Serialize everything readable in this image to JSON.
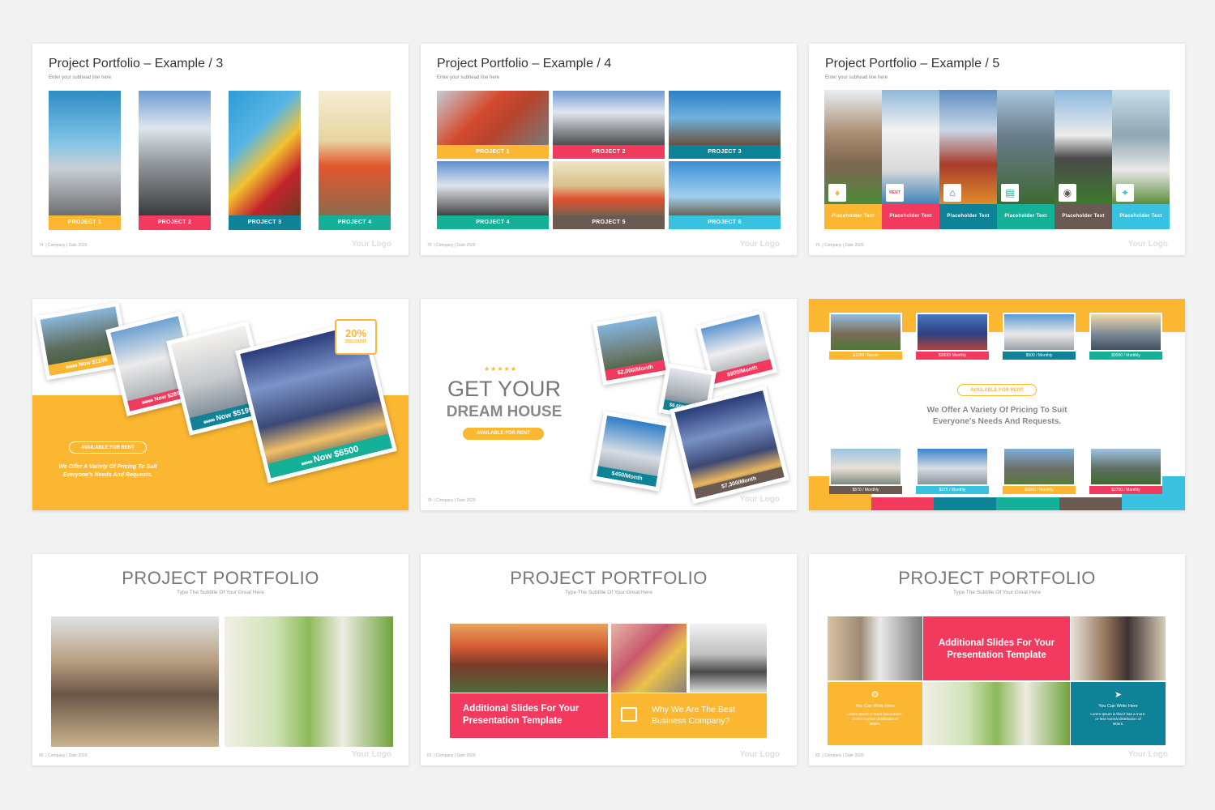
{
  "slides": {
    "s74": {
      "title": "Project Portfolio – Example / 3",
      "subhead": "Enter your subhead line here",
      "page": "74",
      "footer": "| Company | Date 2020",
      "logo": "Your Logo",
      "projects": [
        "PROJECT 1",
        "PROJECT 2",
        "PROJECT 3",
        "PROJECT 4"
      ]
    },
    "s75": {
      "title": "Project Portfolio – Example / 4",
      "subhead": "Enter your subhead line here",
      "page": "75",
      "footer": "| Company | Date 2020",
      "logo": "Your Logo",
      "projects": [
        "PROJECT 1",
        "PROJECT 2",
        "PROJECT 3",
        "PROJECT 4",
        "PROJECT 5",
        "PROJECT 6"
      ]
    },
    "s76": {
      "title": "Project Portfolio – Example / 5",
      "subhead": "Enter your subhead line here",
      "page": "76",
      "footer": "| Company | Date 2020",
      "logo": "Your Logo",
      "placeholders": [
        "Placeholder Text",
        "Placeholder Text",
        "Placeholder Text",
        "Placeholder Text",
        "Placeholder Text",
        "Placeholder Text"
      ],
      "icons": [
        "tag-icon",
        "rent-sign-icon",
        "house-location-icon",
        "document-icon",
        "map-pin-icon",
        "handshake-icon"
      ],
      "rent": "RENT"
    },
    "s77": {
      "discount": "20%",
      "discount_label": "DISCOUNT",
      "pill": "AVAILABLE FOR RENT",
      "desc1": "We Offer A Variety Of Pricing To Suit",
      "desc2": "Everyone's Needs And Requests.",
      "cards": [
        {
          "old": "$1999",
          "now": "Now $1199"
        },
        {
          "old": "$3999",
          "now": "Now $2899"
        },
        {
          "old": "$6999",
          "now": "Now $5199"
        },
        {
          "old": "$9000",
          "now": "Now $6500"
        }
      ]
    },
    "s78": {
      "stars": "★★★★★",
      "line1": "GET YOUR",
      "line2": "DREAM HOUSE",
      "pill": "AVAILABLE FOR RENT",
      "page": "78",
      "footer": "| Company | Date 2020",
      "logo": "Your Logo",
      "prices": [
        "$2,000/Month",
        "$900/Month",
        "$6,600/Month",
        "$450/Month",
        "$7,300/Month"
      ]
    },
    "s79": {
      "pill": "AVAILABLE FOR RENT",
      "desc1": "We Offer A Variety Of Pricing To Suit",
      "desc2": "Everyone's Needs And Requests.",
      "top": [
        "$1199 / Month",
        "$3000/ Monthly",
        "$500 / Monthly",
        "$9000 / Monthly"
      ],
      "bottom": [
        "$570 / Monthly",
        "$375 / Monthly",
        "$9000 / Monthly",
        "$2750 / Monthly"
      ]
    },
    "s80": {
      "title": "PROJECT PORTFOLIO",
      "subtitle": "Type The Subtitle Of Your Great Here",
      "page": "80",
      "footer": "| Company | Date 2020",
      "logo": "Your Logo"
    },
    "s81": {
      "title": "PROJECT PORTFOLIO",
      "subtitle": "Type The Subtitle Of Your Great Here",
      "page": "81",
      "footer": "| Company | Date 2020",
      "logo": "Your Logo",
      "box1": "Additional Slides For Your Presentation Template",
      "box2": "Why We Are The Best Business Company?"
    },
    "s82": {
      "title": "PROJECT PORTFOLIO",
      "subtitle": "Type The Subtitle Of Your Great Here",
      "page": "82",
      "footer": "| Company | Date 2020",
      "logo": "Your Logo",
      "box1": "Additional Slides For Your Presentation Template",
      "card1_title": "You Can Write Here",
      "card1_body": "Lorem Ipsum is that it has a more-or-less normal distribution of letters.",
      "card2_title": "You Can Write Here",
      "card2_body": "Lorem Ipsum is that it has a more-or-less normal distribution of letters."
    }
  },
  "colors": {
    "yellow": "#fbb731",
    "pink": "#f23a5f",
    "teal": "#0e8296",
    "green": "#14b097",
    "brown": "#6b5a52",
    "cyan": "#38c2df"
  }
}
